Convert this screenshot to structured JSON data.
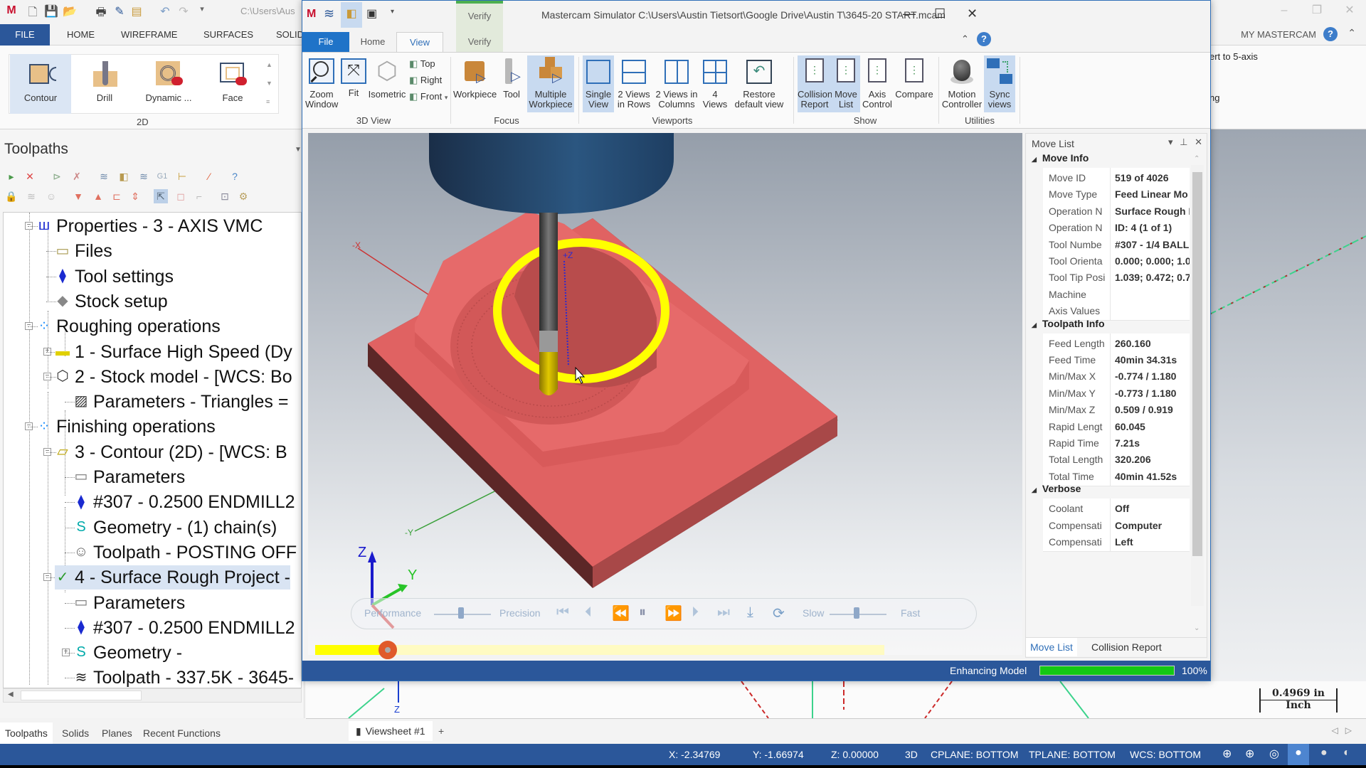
{
  "main_window": {
    "title_path": "C:\\Users\\Aus",
    "tabs": [
      "FILE",
      "HOME",
      "WIREFRAME",
      "SURFACES",
      "SOLID"
    ],
    "my_mastercam": "MY MASTERCAM",
    "ribbon_2d": {
      "group_label": "2D",
      "buttons": [
        {
          "label": "Contour",
          "selected": true
        },
        {
          "label": "Drill"
        },
        {
          "label": "Dynamic ..."
        },
        {
          "label": "Face"
        }
      ]
    },
    "ribbon_right_items": [
      "ert to 5-axis",
      "ng"
    ]
  },
  "toolpaths_panel": {
    "title": "Toolpaths",
    "tree": [
      {
        "label": "Properties - 3 - AXIS VMC",
        "icon": "machine-icon",
        "level": 0,
        "expander": "minus"
      },
      {
        "label": "Files",
        "icon": "folder-icon",
        "level": 1
      },
      {
        "label": "Tool settings",
        "icon": "tool-icon",
        "level": 1
      },
      {
        "label": "Stock setup",
        "icon": "stock-icon",
        "level": 1
      },
      {
        "label": "Roughing operations",
        "icon": "group-icon",
        "level": 0,
        "expander": "minus"
      },
      {
        "label": "1 - Surface High Speed (Dy",
        "icon": "folder-yellow-icon",
        "level": 1,
        "expander": "plus"
      },
      {
        "label": "2 - Stock model - [WCS: Bo",
        "icon": "stock-model-icon",
        "level": 1,
        "expander": "minus"
      },
      {
        "label": "Parameters - Triangles =",
        "icon": "parameters-hatched-icon",
        "level": 2
      },
      {
        "label": "Finishing operations",
        "icon": "group-icon",
        "level": 0,
        "expander": "minus"
      },
      {
        "label": "3 - Contour (2D) - [WCS: B",
        "icon": "folder-open-icon",
        "level": 1,
        "expander": "minus"
      },
      {
        "label": "Parameters",
        "icon": "parameters-folder-icon",
        "level": 2
      },
      {
        "label": "#307 - 0.2500 ENDMILL2",
        "icon": "tool-icon",
        "level": 2
      },
      {
        "label": "Geometry -  (1) chain(s)",
        "icon": "geometry-icon",
        "level": 2
      },
      {
        "label": "Toolpath - POSTING OFF",
        "icon": "ghost-icon",
        "level": 2
      },
      {
        "label": "4 - Surface Rough Project -",
        "icon": "folder-check-icon",
        "level": 1,
        "expander": "minus",
        "selected": true
      },
      {
        "label": "Parameters",
        "icon": "parameters-folder-icon",
        "level": 2
      },
      {
        "label": "#307 - 0.2500 ENDMILL2",
        "icon": "tool-icon",
        "level": 2
      },
      {
        "label": "Geometry -",
        "icon": "geometry-icon",
        "level": 2,
        "expander": "plus"
      },
      {
        "label": "Toolpath - 337.5K - 3645-",
        "icon": "toolpath-icon",
        "level": 2
      }
    ],
    "bottom_tabs": [
      {
        "label": "Toolpaths",
        "active": true
      },
      {
        "label": "Solids"
      },
      {
        "label": "Planes"
      },
      {
        "label": "Recent Functions"
      }
    ]
  },
  "simulator": {
    "title": "Mastercam Simulator  C:\\Users\\Austin Tietsort\\Google Drive\\Austin T\\3645-20 START.mcam",
    "context_tab": "Verify",
    "tabs": [
      {
        "label": "File"
      },
      {
        "label": "Home"
      },
      {
        "label": "View",
        "active": true
      },
      {
        "label": "Verify"
      }
    ],
    "ribbon": {
      "groups": [
        {
          "label": "3D View",
          "buttons": [
            "Zoom\nWindow",
            "Fit",
            "Isometric"
          ],
          "small": [
            "Top",
            "Right",
            "Front"
          ]
        },
        {
          "label": "Focus",
          "buttons": [
            "Workpiece",
            "Tool",
            "Multiple\nWorkpiece"
          ]
        },
        {
          "label": "Viewports",
          "buttons": [
            "Single\nView",
            "2 Views\nin Rows",
            "2 Views in\nColumns",
            "4\nViews",
            "Restore\ndefault view"
          ]
        },
        {
          "label": "Show",
          "buttons": [
            "Collision\nReport",
            "Move\nList",
            "Axis\nControl",
            "Compare"
          ]
        },
        {
          "label": "Utilities",
          "buttons": [
            "Motion\nController",
            "Sync\nviews"
          ]
        }
      ],
      "zoom_window": "Zoom Window",
      "fit": "Fit",
      "isometric": "Isometric",
      "top": "Top",
      "right": "Right",
      "front": "Front",
      "workpiece": "Workpiece",
      "tool": "Tool",
      "multiple_workpiece_1": "Multiple",
      "multiple_workpiece_2": "Workpiece",
      "single_view_1": "Single",
      "single_view_2": "View",
      "views_rows_1": "2 Views",
      "views_rows_2": "in Rows",
      "views_cols_1": "2 Views in",
      "views_cols_2": "Columns",
      "four_views_1": "4",
      "four_views_2": "Views",
      "restore_1": "Restore",
      "restore_2": "default view",
      "collision_1": "Collision",
      "collision_2": "Report",
      "movelist_1": "Move",
      "movelist_2": "List",
      "axis_1": "Axis",
      "axis_2": "Control",
      "compare": "Compare",
      "motion_1": "Motion",
      "motion_2": "Controller",
      "sync_1": "Sync",
      "sync_2": "views",
      "group_3dview": "3D View",
      "group_focus": "Focus",
      "group_viewports": "Viewports",
      "group_show": "Show",
      "group_utilities": "Utilities"
    },
    "viewport": {
      "axis_labels": {
        "neg_x": "-X",
        "pos_z": "+Z",
        "pos_y": "+Y",
        "neg_y": "-Y",
        "triad_z": "Z",
        "triad_y": "Y"
      },
      "colors": {
        "stock": "#e06262",
        "tool_holder": "#2b5680",
        "toolpath": "#ffff00"
      }
    },
    "playback": {
      "performance": "Performance",
      "precision": "Precision",
      "slow": "Slow",
      "fast": "Fast",
      "progress_fraction": 0.128
    },
    "move_list": {
      "title": "Move List",
      "sections": [
        {
          "name": "Move Info",
          "rows": [
            {
              "key": "Move ID",
              "value": "519 of 4026"
            },
            {
              "key": "Move Type",
              "value": "Feed Linear Mo"
            },
            {
              "key": "Operation N",
              "value": "Surface Rough I"
            },
            {
              "key": "Operation N",
              "value": "ID: 4 (1 of 1)"
            },
            {
              "key": "Tool Numbe",
              "value": "#307 - 1/4 BALL"
            },
            {
              "key": "Tool Orienta",
              "value": "0.000; 0.000; 1.0"
            },
            {
              "key": "Tool Tip Posi",
              "value": "1.039; 0.472; 0.7"
            },
            {
              "key": "Machine",
              "value": ""
            },
            {
              "key": "Axis Values",
              "value": ""
            }
          ]
        },
        {
          "name": "Toolpath Info",
          "rows": [
            {
              "key": "Feed Length",
              "value": "260.160"
            },
            {
              "key": "Feed Time",
              "value": "40min 34.31s"
            },
            {
              "key": "Min/Max X",
              "value": "-0.774 / 1.180"
            },
            {
              "key": "Min/Max Y",
              "value": "-0.773 / 1.180"
            },
            {
              "key": "Min/Max Z",
              "value": "0.509 / 0.919"
            },
            {
              "key": "Rapid Lengt",
              "value": "60.045"
            },
            {
              "key": "Rapid Time",
              "value": "7.21s"
            },
            {
              "key": "Total Length",
              "value": "320.206"
            },
            {
              "key": "Total Time",
              "value": "40min 41.52s"
            }
          ]
        },
        {
          "name": "Verbose",
          "rows": [
            {
              "key": "Coolant",
              "value": "Off"
            },
            {
              "key": "Compensati",
              "value": "Computer"
            },
            {
              "key": "Compensati",
              "value": "Left"
            }
          ]
        }
      ],
      "tabs": [
        {
          "label": "Move List",
          "active": true
        },
        {
          "label": "Collision Report"
        }
      ]
    },
    "status": {
      "label": "Enhancing Model",
      "percent_text": "100%",
      "progress": 1.0
    }
  },
  "viewsheet": {
    "tab": "Viewsheet #1",
    "add": "+"
  },
  "scale": {
    "value": "0.4969 in",
    "unit": "Inch"
  },
  "statusbar": {
    "x": "X:  -2.34769",
    "y": "Y:  -1.66974",
    "z": "Z:  0.00000",
    "mode": "3D",
    "cplane": "CPLANE: BOTTOM",
    "tplane": "TPLANE: BOTTOM",
    "wcs": "WCS: BOTTOM"
  }
}
